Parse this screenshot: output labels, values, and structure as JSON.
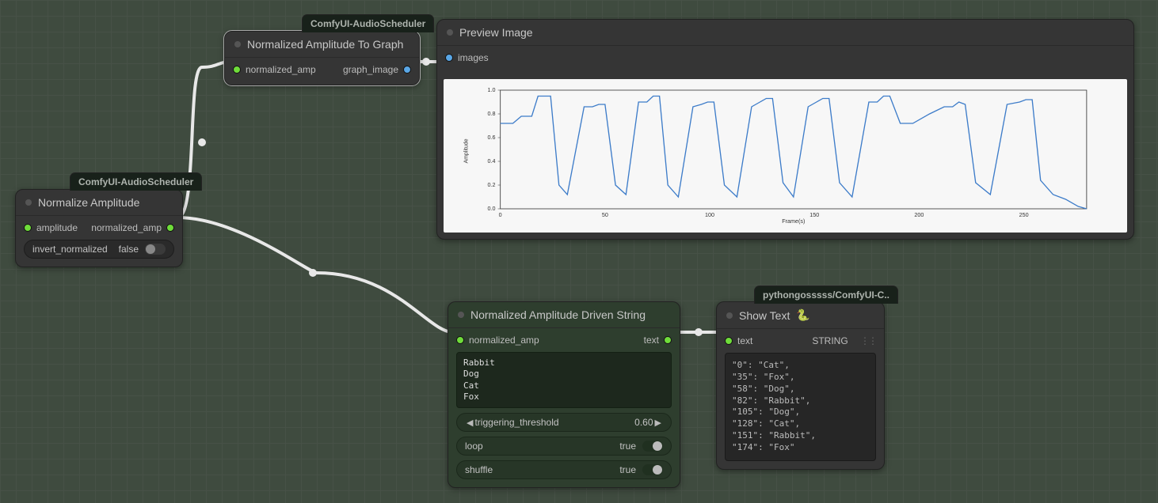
{
  "badges": {
    "normalize": "ComfyUI-AudioScheduler",
    "graph": "ComfyUI-AudioScheduler",
    "showtext": "pythongosssss/ComfyUI-C.."
  },
  "nodes": {
    "normalize": {
      "title": "Normalize Amplitude",
      "in": "amplitude",
      "out": "normalized_amp",
      "widget_label": "invert_normalized",
      "widget_value": "false"
    },
    "graph": {
      "title": "Normalized Amplitude To Graph",
      "in": "normalized_amp",
      "out": "graph_image"
    },
    "preview": {
      "title": "Preview Image",
      "in": "images"
    },
    "driven": {
      "title": "Normalized Amplitude Driven String",
      "in": "normalized_amp",
      "out": "text",
      "textarea": "Rabbit\nDog\nCat\nFox",
      "threshold_label": "triggering_threshold",
      "threshold_value": "0.60",
      "loop_label": "loop",
      "loop_value": "true",
      "shuffle_label": "shuffle",
      "shuffle_value": "true"
    },
    "showtext": {
      "title": "Show Text ",
      "emoji": "🐍",
      "in": "text",
      "outtype": "STRING",
      "content": "\"0\": \"Cat\",\n\"35\": \"Fox\",\n\"58\": \"Dog\",\n\"82\": \"Rabbit\",\n\"105\": \"Dog\",\n\"128\": \"Cat\",\n\"151\": \"Rabbit\",\n\"174\": \"Fox\""
    }
  },
  "chart_data": {
    "type": "line",
    "title": "",
    "xlabel": "Frame(s)",
    "ylabel": "Amplitude",
    "xlim": [
      0,
      280
    ],
    "ylim": [
      0.0,
      1.0
    ],
    "xticks": [
      0,
      50,
      100,
      150,
      200,
      250
    ],
    "yticks": [
      0.0,
      0.2,
      0.4,
      0.6,
      0.8,
      1.0
    ],
    "x": [
      0,
      6,
      10,
      15,
      18,
      22,
      24,
      28,
      32,
      40,
      44,
      47,
      50,
      55,
      60,
      66,
      70,
      73,
      76,
      80,
      85,
      92,
      96,
      99,
      102,
      107,
      113,
      120,
      124,
      127,
      130,
      135,
      140,
      147,
      151,
      154,
      157,
      162,
      168,
      176,
      180,
      183,
      186,
      191,
      197,
      205,
      212,
      216,
      219,
      222,
      227,
      234,
      242,
      248,
      251,
      254,
      258,
      264,
      270,
      276,
      280
    ],
    "values": [
      0.72,
      0.72,
      0.78,
      0.78,
      0.95,
      0.95,
      0.95,
      0.2,
      0.12,
      0.86,
      0.86,
      0.88,
      0.88,
      0.2,
      0.12,
      0.9,
      0.9,
      0.95,
      0.95,
      0.2,
      0.1,
      0.86,
      0.88,
      0.9,
      0.9,
      0.2,
      0.1,
      0.86,
      0.9,
      0.93,
      0.93,
      0.22,
      0.1,
      0.86,
      0.9,
      0.93,
      0.93,
      0.22,
      0.1,
      0.9,
      0.9,
      0.95,
      0.95,
      0.72,
      0.72,
      0.8,
      0.86,
      0.86,
      0.9,
      0.88,
      0.22,
      0.12,
      0.88,
      0.9,
      0.92,
      0.92,
      0.24,
      0.12,
      0.08,
      0.02,
      0.0
    ]
  }
}
